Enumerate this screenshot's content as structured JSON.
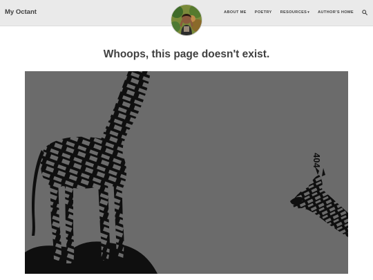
{
  "navbar": {
    "brand": "My Octant",
    "links": [
      {
        "label": "ABOUT ME"
      },
      {
        "label": "POETRY"
      },
      {
        "label": "RESOURCES"
      },
      {
        "label": "AUTHOR'S HOME"
      }
    ],
    "resources_caret": "▾",
    "icons": {
      "search": "search-icon",
      "avatar": "avatar-photo"
    },
    "bg_color": "#eaeaea"
  },
  "main": {
    "heading": "Whoops, this page doesn't exist.",
    "art_text": "404",
    "art_bg": "#6b6b6b"
  }
}
